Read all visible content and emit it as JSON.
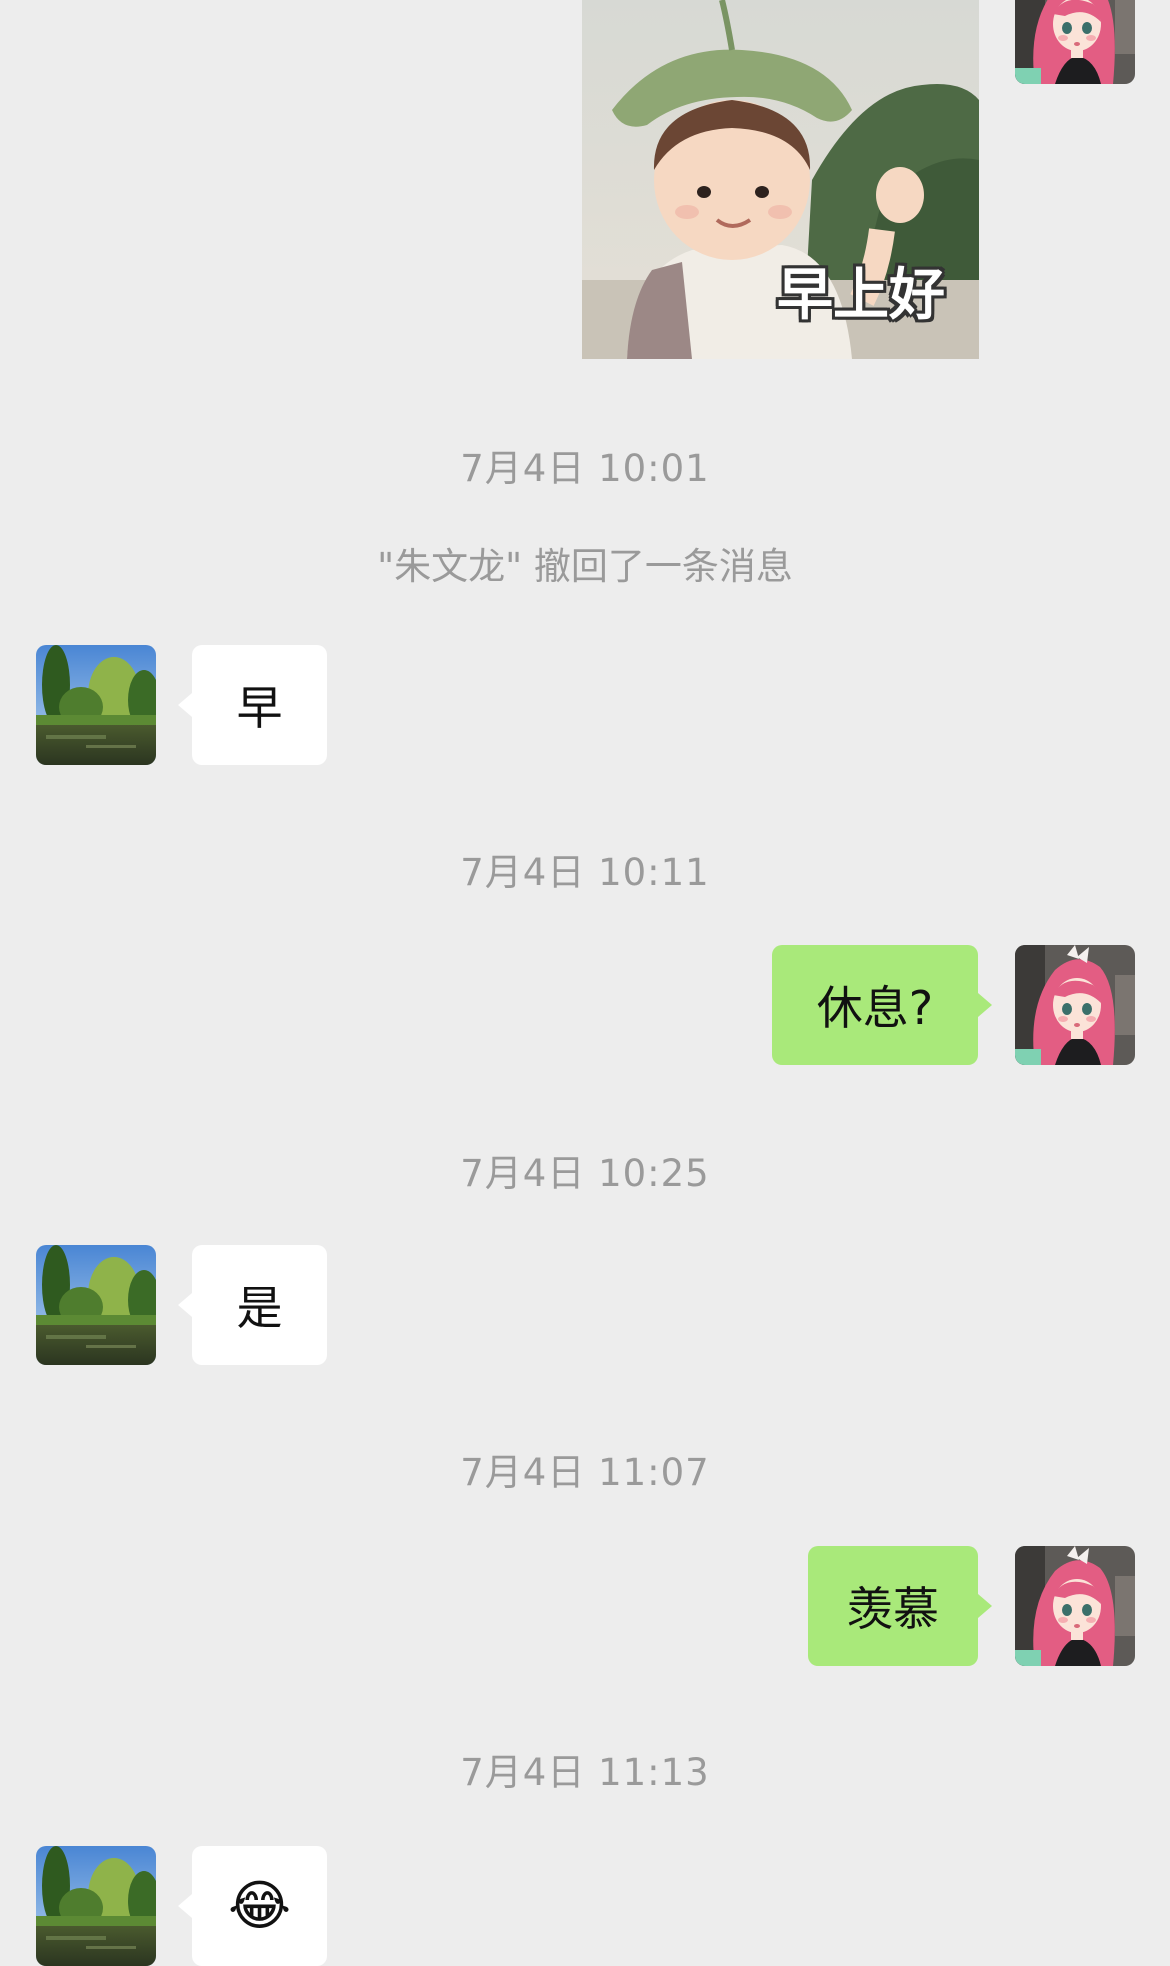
{
  "chat": {
    "sticker_caption": "早上好",
    "messages": [
      {
        "time": "7月4日 10:01"
      },
      {
        "system": "\"朱文龙\" 撤回了一条消息"
      },
      {
        "from": "other",
        "text": "早"
      },
      {
        "time": "7月4日 10:11"
      },
      {
        "from": "me",
        "text": "休息?"
      },
      {
        "time": "7月4日 10:25"
      },
      {
        "from": "other",
        "text": "是"
      },
      {
        "time": "7月4日 11:07"
      },
      {
        "from": "me",
        "text": "羡慕"
      },
      {
        "time": "7月4日 11:13"
      },
      {
        "from": "other",
        "text": "😂"
      }
    ]
  },
  "avatars": {
    "me": "anime-girl-avatar",
    "other": "landscape-tree-avatar"
  },
  "colors": {
    "background": "#ededed",
    "bubble_me": "#a9e97a",
    "bubble_other": "#ffffff",
    "timestamp": "#9a9a9a"
  }
}
